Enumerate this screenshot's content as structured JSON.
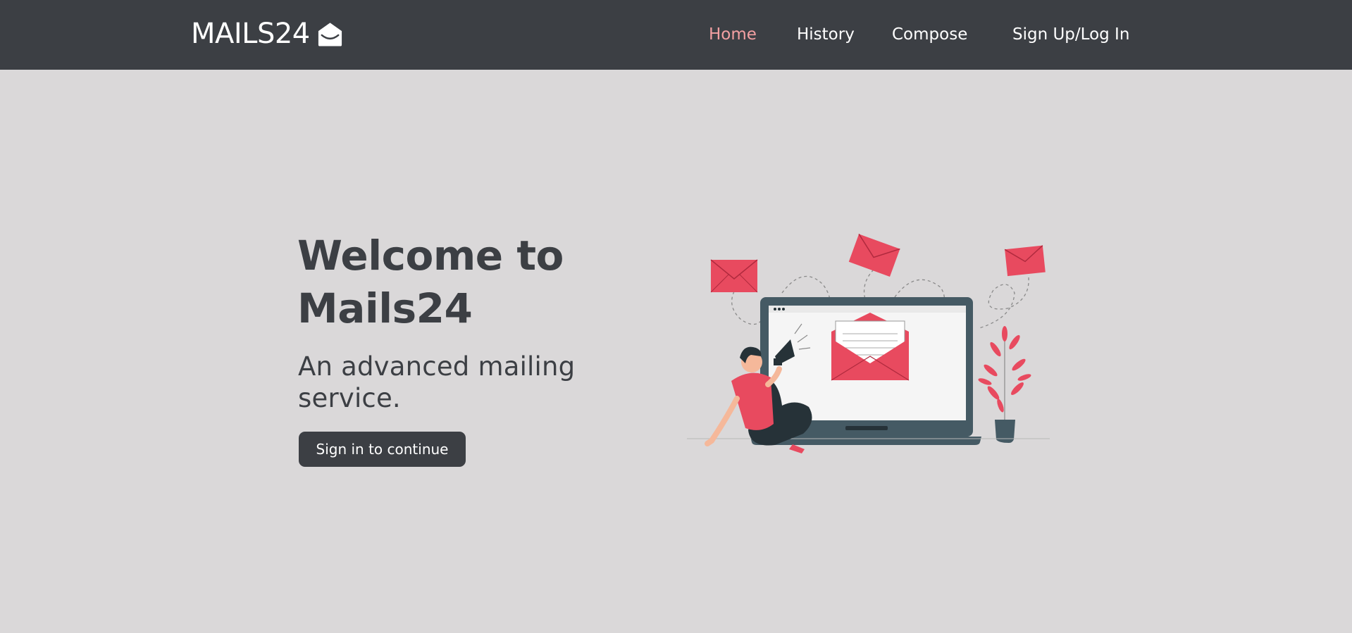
{
  "navbar": {
    "brand": "MAILS24",
    "brand_icon": "open-envelope-icon",
    "links": [
      {
        "label": "Home",
        "active": true
      },
      {
        "label": "History",
        "active": false
      },
      {
        "label": "Compose",
        "active": false
      },
      {
        "label": "Sign Up/Log In",
        "active": false
      }
    ],
    "active_color": "#f3a0a2"
  },
  "hero": {
    "title_line1": "Welcome to",
    "title_line2": "Mails24",
    "subtitle_line1": "An advanced mailing",
    "subtitle_line2": "service.",
    "button_label": "Sign in to continue",
    "illustration": "person-with-megaphone-laptop-envelopes-illustration"
  },
  "colors": {
    "navbar_bg": "#3c3f44",
    "page_bg": "#dad8d9",
    "accent_red": "#e84a5f",
    "text_dark": "#3c3f44"
  }
}
